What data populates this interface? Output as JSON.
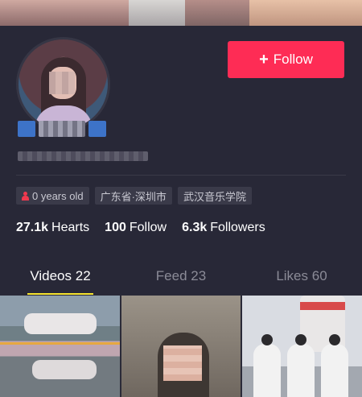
{
  "profile": {
    "follow_label": "Follow",
    "tags": {
      "age": "0 years old",
      "location": "广东省·深圳市",
      "school": "武汉音乐学院"
    },
    "stats": [
      {
        "value": "27.1k",
        "label": "Hearts"
      },
      {
        "value": "100",
        "label": "Follow"
      },
      {
        "value": "6.3k",
        "label": "Followers"
      }
    ]
  },
  "tabs": [
    {
      "label": "Videos 22",
      "active": true
    },
    {
      "label": "Feed 23",
      "active": false
    },
    {
      "label": "Likes 60",
      "active": false
    }
  ],
  "colors": {
    "background": "#282837",
    "follow_button": "#fe2c55",
    "tab_underline": "#f7e52f",
    "tag_background": "#3a3a49"
  },
  "icons": {
    "follow": "plus-icon",
    "age_tag": "person-icon"
  }
}
